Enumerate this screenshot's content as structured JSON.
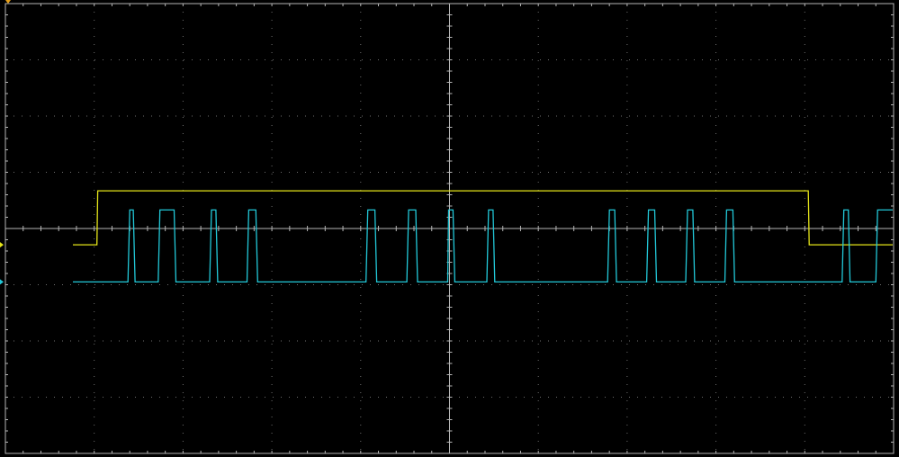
{
  "chart_data": {
    "type": "line",
    "title": "",
    "xlabel": "",
    "ylabel": "",
    "grid": true,
    "divisions": {
      "x": 10,
      "y": 8
    },
    "subdivisions": 5,
    "xlim": [
      -5,
      5
    ],
    "ylim": [
      -4,
      4
    ],
    "colors": {
      "background": "#000000",
      "grid": "#8a8a8a",
      "border": "#b5b5b5",
      "ch1": "#e6e619",
      "ch2": "#22c8d8"
    },
    "series": [
      {
        "channel": "ch1",
        "x": [
          -4.24,
          -3.97,
          -3.96,
          4.04,
          4.05,
          4.99
        ],
        "y": [
          -0.29,
          -0.29,
          0.67,
          0.67,
          -0.29,
          -0.29
        ]
      },
      {
        "channel": "ch2",
        "x": [
          -4.24,
          -3.62,
          -3.6,
          -3.56,
          -3.54,
          -3.28,
          -3.26,
          -3.1,
          -3.08,
          -2.7,
          -2.68,
          -2.63,
          -2.61,
          -2.28,
          -2.26,
          -2.18,
          -2.16,
          -0.94,
          -0.92,
          -0.84,
          -0.82,
          -0.48,
          -0.46,
          -0.38,
          -0.36,
          -0.02,
          -0.01,
          0.04,
          0.06,
          0.42,
          0.44,
          0.49,
          0.51,
          1.78,
          1.8,
          1.86,
          1.88,
          2.22,
          2.24,
          2.31,
          2.33,
          2.66,
          2.68,
          2.74,
          2.76,
          3.1,
          3.12,
          3.19,
          3.21,
          4.42,
          4.44,
          4.49,
          4.51,
          4.8,
          4.82,
          4.99
        ],
        "y": [
          -0.95,
          -0.95,
          0.33,
          0.33,
          -0.95,
          -0.95,
          0.33,
          0.33,
          -0.95,
          -0.95,
          0.33,
          0.33,
          -0.95,
          -0.95,
          0.33,
          0.33,
          -0.95,
          -0.95,
          0.33,
          0.33,
          -0.95,
          -0.95,
          0.33,
          0.33,
          -0.95,
          -0.95,
          0.33,
          0.33,
          -0.95,
          -0.95,
          0.33,
          0.33,
          -0.95,
          -0.95,
          0.33,
          0.33,
          -0.95,
          -0.95,
          0.33,
          0.33,
          -0.95,
          -0.95,
          0.33,
          0.33,
          -0.95,
          -0.95,
          0.33,
          0.33,
          -0.95,
          -0.95,
          0.33,
          0.33,
          -0.95,
          -0.95,
          0.33,
          0.33
        ]
      }
    ],
    "markers": [
      {
        "channel": "ch1",
        "side": "left",
        "y": -0.29,
        "color": "#e6e619"
      },
      {
        "channel": "ch2",
        "side": "left",
        "y": -0.95,
        "color": "#22c8d8"
      },
      {
        "channel": "trigger",
        "side": "top",
        "x": -5,
        "color": "#e6a019"
      }
    ]
  }
}
